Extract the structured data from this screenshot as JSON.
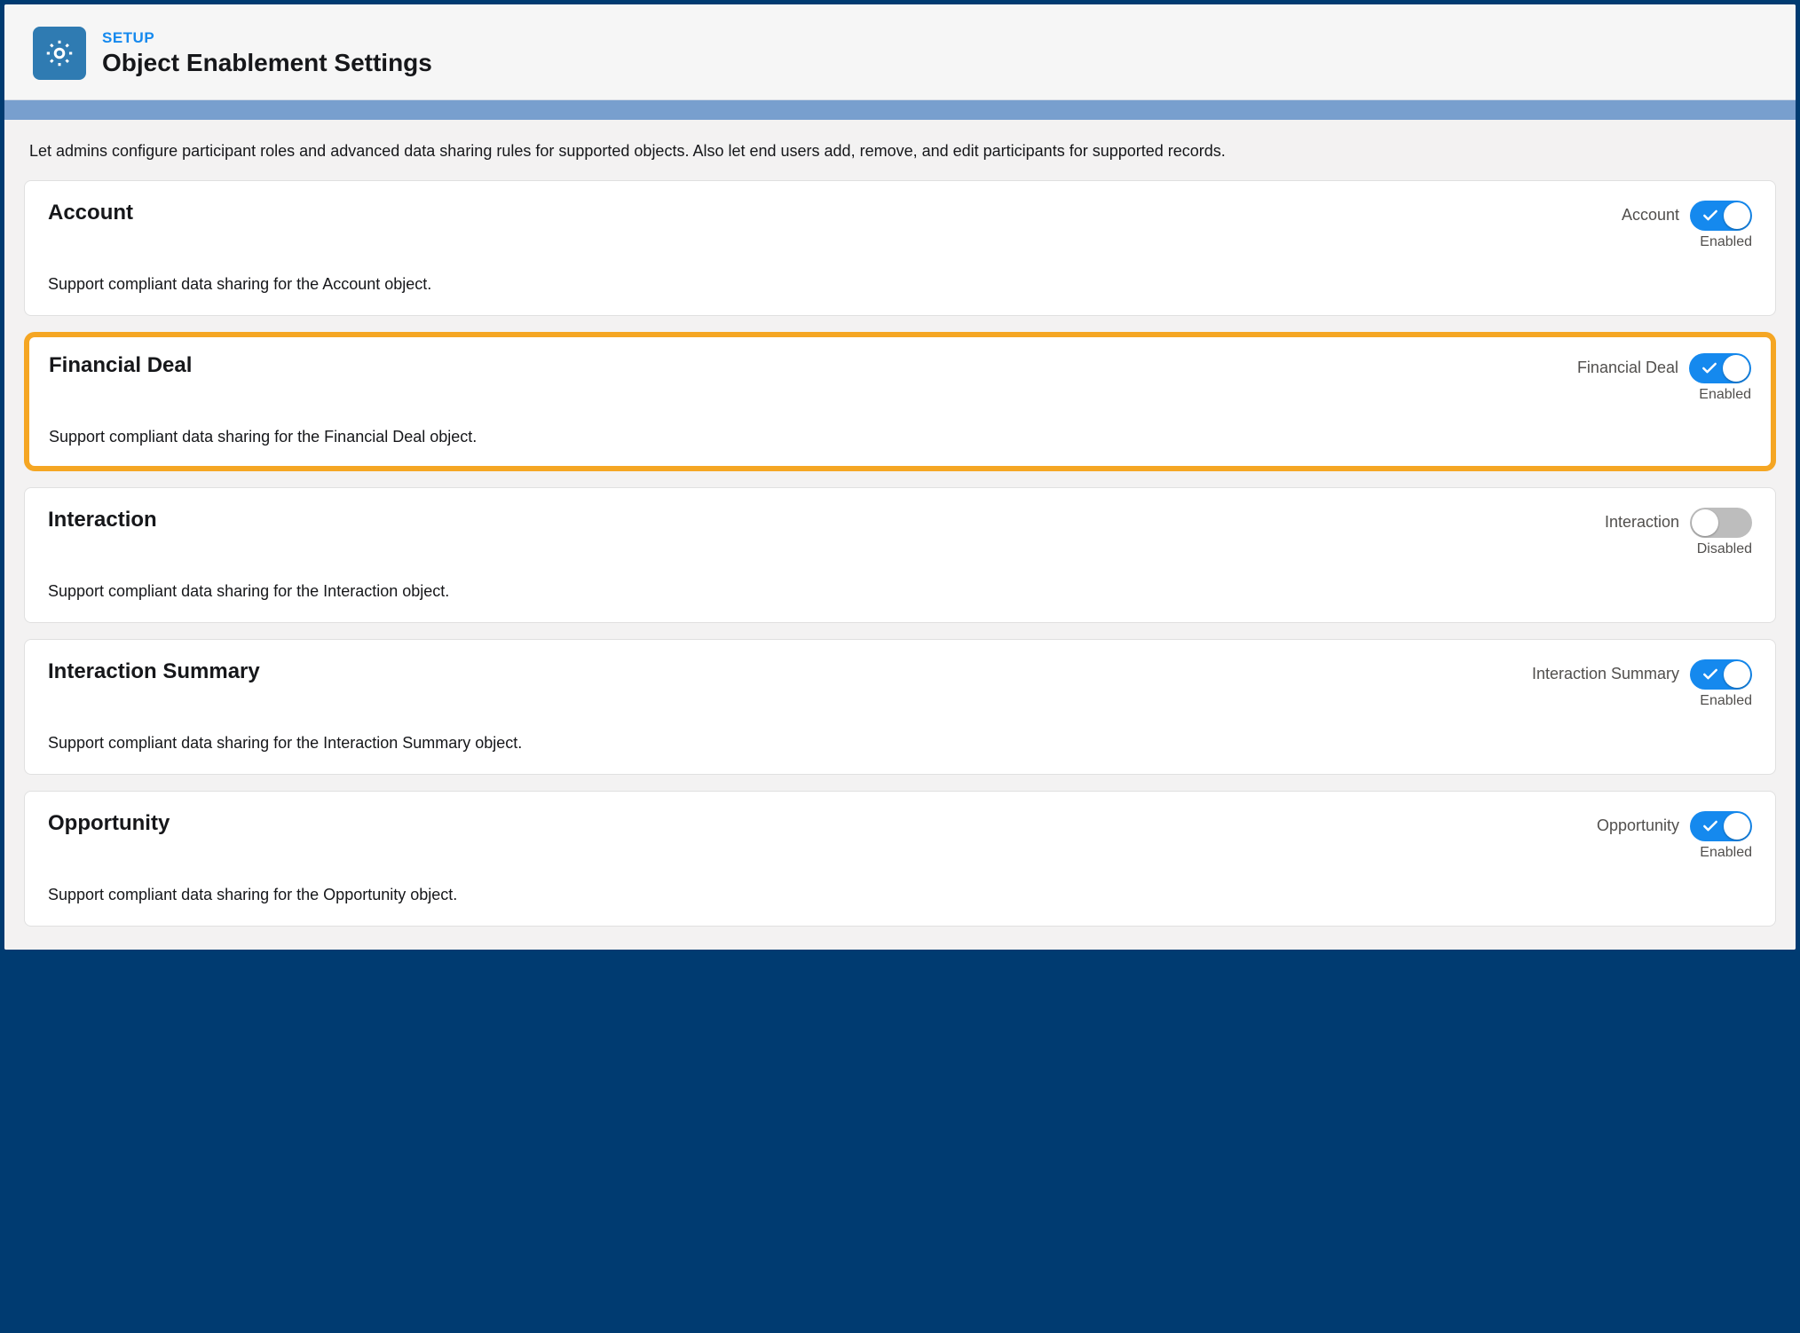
{
  "header": {
    "setup_label": "SETUP",
    "title": "Object Enablement Settings"
  },
  "intro": "Let admins configure participant roles and advanced data sharing rules for supported objects. Also let end users add, remove, and edit participants for supported records.",
  "state_labels": {
    "enabled": "Enabled",
    "disabled": "Disabled"
  },
  "objects": [
    {
      "title": "Account",
      "description": "Support compliant data sharing for the Account object.",
      "toggle_label": "Account",
      "enabled": true,
      "highlighted": false
    },
    {
      "title": "Financial Deal",
      "description": "Support compliant data sharing for the Financial Deal object.",
      "toggle_label": "Financial Deal",
      "enabled": true,
      "highlighted": true
    },
    {
      "title": "Interaction",
      "description": "Support compliant data sharing for the Interaction object.",
      "toggle_label": "Interaction",
      "enabled": false,
      "highlighted": false
    },
    {
      "title": "Interaction Summary",
      "description": "Support compliant data sharing for the Interaction Summary object.",
      "toggle_label": "Interaction Summary",
      "enabled": true,
      "highlighted": false
    },
    {
      "title": "Opportunity",
      "description": "Support compliant data sharing for the Opportunity object.",
      "toggle_label": "Opportunity",
      "enabled": true,
      "highlighted": false
    }
  ]
}
